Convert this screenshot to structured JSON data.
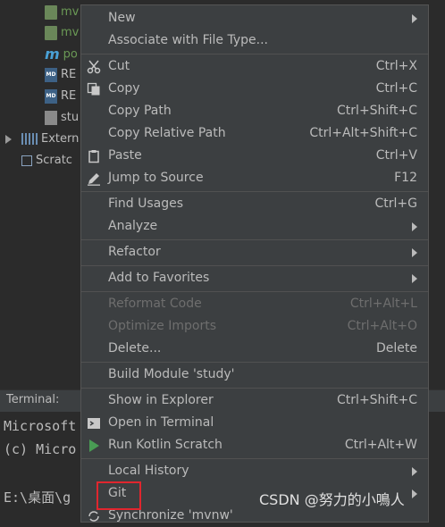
{
  "tree": {
    "items": [
      {
        "label": "mv",
        "icon": "file-icon"
      },
      {
        "label": "mv",
        "icon": "file-icon"
      },
      {
        "label": "po",
        "icon": "maven-m-icon"
      },
      {
        "label": "RE",
        "icon": "md-file-icon"
      },
      {
        "label": "RE",
        "icon": "md-file-icon"
      },
      {
        "label": "stu",
        "icon": "text-file-icon"
      },
      {
        "label": "Extern",
        "icon": "library-icon"
      },
      {
        "label": "Scratc",
        "icon": "scratch-icon"
      }
    ]
  },
  "terminal": {
    "title": "Terminal:",
    "lines": [
      "Microsoft",
      "(c) Micro",
      "E:\\桌面\\g"
    ]
  },
  "menu": {
    "items": [
      {
        "label": "New",
        "shortcut": "",
        "submenu": true
      },
      {
        "label": "Associate with File Type...",
        "shortcut": ""
      },
      {
        "label": "Cut",
        "shortcut": "Ctrl+X",
        "icon": "scissors-icon"
      },
      {
        "label": "Copy",
        "shortcut": "Ctrl+C",
        "icon": "copy-icon"
      },
      {
        "label": "Copy Path",
        "shortcut": "Ctrl+Shift+C"
      },
      {
        "label": "Copy Relative Path",
        "shortcut": "Ctrl+Alt+Shift+C"
      },
      {
        "label": "Paste",
        "shortcut": "Ctrl+V",
        "icon": "paste-icon"
      },
      {
        "label": "Jump to Source",
        "shortcut": "F12",
        "icon": "pencil-icon"
      },
      {
        "label": "Find Usages",
        "shortcut": "Ctrl+G"
      },
      {
        "label": "Analyze",
        "shortcut": "",
        "submenu": true
      },
      {
        "label": "Refactor",
        "shortcut": "",
        "submenu": true
      },
      {
        "label": "Add to Favorites",
        "shortcut": "",
        "submenu": true
      },
      {
        "label": "Reformat Code",
        "shortcut": "Ctrl+Alt+L",
        "disabled": true
      },
      {
        "label": "Optimize Imports",
        "shortcut": "Ctrl+Alt+O",
        "disabled": true
      },
      {
        "label": "Delete...",
        "shortcut": "Delete"
      },
      {
        "label": "Build Module 'study'",
        "shortcut": ""
      },
      {
        "label": "Show in Explorer",
        "shortcut": "Ctrl+Shift+C"
      },
      {
        "label": "Open in Terminal",
        "shortcut": "",
        "icon": "terminal-icon"
      },
      {
        "label": "Run Kotlin Scratch",
        "shortcut": "Ctrl+Alt+W",
        "icon": "run-icon"
      },
      {
        "label": "Local History",
        "shortcut": "",
        "submenu": true
      },
      {
        "label": "Git",
        "shortcut": "",
        "submenu": true
      },
      {
        "label": "Synchronize 'mvnw'",
        "shortcut": "",
        "icon": "sync-icon"
      }
    ]
  },
  "watermark": "CSDN @努力的小鳴人",
  "colors": {
    "highlight_box": "#e0262e",
    "run_green": "#499c54"
  }
}
